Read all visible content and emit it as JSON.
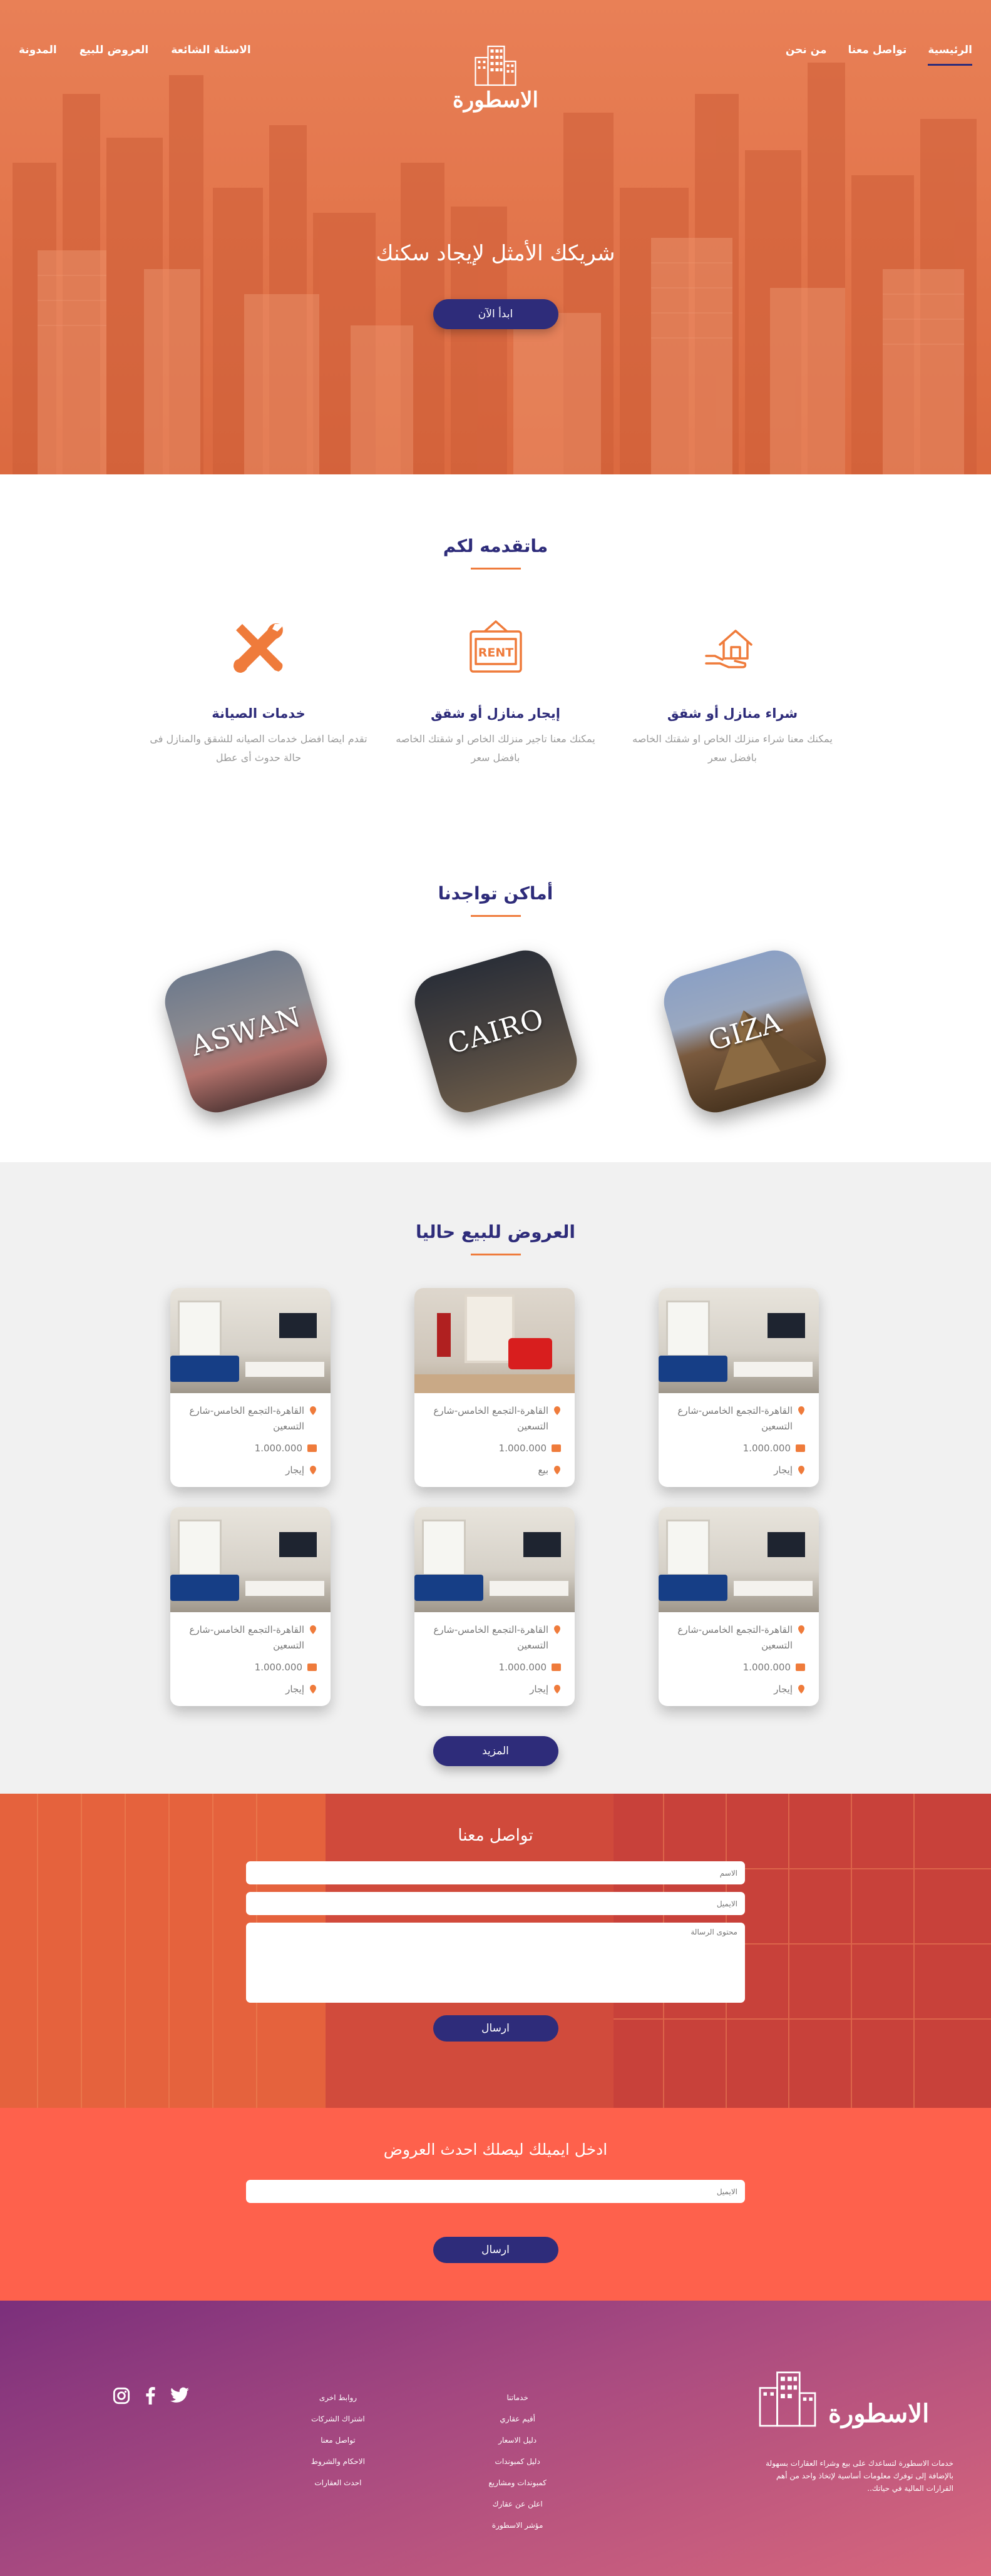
{
  "nav": {
    "right": [
      {
        "label": "الرئيسية",
        "active": true
      },
      {
        "label": "تواصل معنا",
        "active": false
      },
      {
        "label": "من نحن",
        "active": false
      }
    ],
    "left": [
      {
        "label": "الاسئلة الشائعة"
      },
      {
        "label": "العروض للبيع"
      },
      {
        "label": "المدونة"
      }
    ]
  },
  "brand": {
    "name": "الاسطورة"
  },
  "hero": {
    "headline": "شريكك الأمثل لإيجاد سكنك",
    "cta": "ابدأ الآن"
  },
  "services": {
    "title": "ماتقدمه لكم",
    "items": [
      {
        "icon": "house-in-hand-icon",
        "title": "شراء منازل أو شقق",
        "text": "يمكنك معنا شراء منزلك الخاص او شقتك الخاصه بافضل سعر"
      },
      {
        "icon": "rent-sign-icon",
        "title": "إيجار منازل أو شقق",
        "text": "يمكنك معنا تاجير منزلك الخاص او شقتك الخاصه بافضل سعر"
      },
      {
        "icon": "tools-icon",
        "title": "خدمات الصيانة",
        "text": "تقدم ايضا افضل خدمات الصيانه للشقق والمنازل فى حالة حدوث أى عطل"
      }
    ]
  },
  "locations": {
    "title": "أماكن تواجدنا",
    "items": [
      "GIZA",
      "CAIRO",
      "ASWAN"
    ]
  },
  "listings": {
    "title": "العروض للبيع حاليا",
    "cards": [
      {
        "address": "القاهرة-التجمع الخامس-شارع التسعين",
        "price": "1.000.000",
        "type": "إيجار"
      },
      {
        "address": "القاهرة-التجمع الخامس-شارع التسعين",
        "price": "1.000.000",
        "type": "بيع"
      },
      {
        "address": "القاهرة-التجمع الخامس-شارع التسعين",
        "price": "1.000.000",
        "type": "إيجار"
      },
      {
        "address": "القاهرة-التجمع الخامس-شارع التسعين",
        "price": "1.000.000",
        "type": "إيجار"
      },
      {
        "address": "القاهرة-التجمع الخامس-شارع التسعين",
        "price": "1.000.000",
        "type": "إيجار"
      },
      {
        "address": "القاهرة-التجمع الخامس-شارع التسعين",
        "price": "1.000.000",
        "type": "إيجار"
      }
    ],
    "more": "المزيد"
  },
  "contact": {
    "title": "تواصل معنا",
    "name_placeholder": "الاسم",
    "email_placeholder": "الايميل",
    "message_placeholder": "محتوى الرسالة",
    "send": "ارسال"
  },
  "newsletter": {
    "title": "ادخل ايميلك ليصلك احدث العروض",
    "email_placeholder": "الايميل",
    "send": "ارسال"
  },
  "footer": {
    "description": "خدمات الاسطورة لتساعدك على بيع وشراء العقارات بسهولة بالإضافة إلى توفرك معلومات أساسية لإتخاذ واحد من أهم القرارات المالية في حياتك..",
    "col1": [
      "خدماتنا",
      "أقيم عقاري",
      "دليل الاسعار",
      "دليل كمبوندات",
      "دليل كمبوندات",
      "كمبوندات ومشاريع",
      "اعلن عن عقارك",
      "مؤشر الاسطورة"
    ],
    "col2": [
      "روابط اخرى",
      "اشتراك الشركات",
      "تواصل معنا",
      "الاحكام والشروط",
      "احدث العقارات"
    ],
    "social": [
      "instagram-icon",
      "facebook-icon",
      "twitter-icon"
    ]
  },
  "colors": {
    "accent": "#ef7b3b",
    "primary": "#2e2c7a",
    "hero": "#e5784c",
    "newsletter": "#fe614c"
  }
}
